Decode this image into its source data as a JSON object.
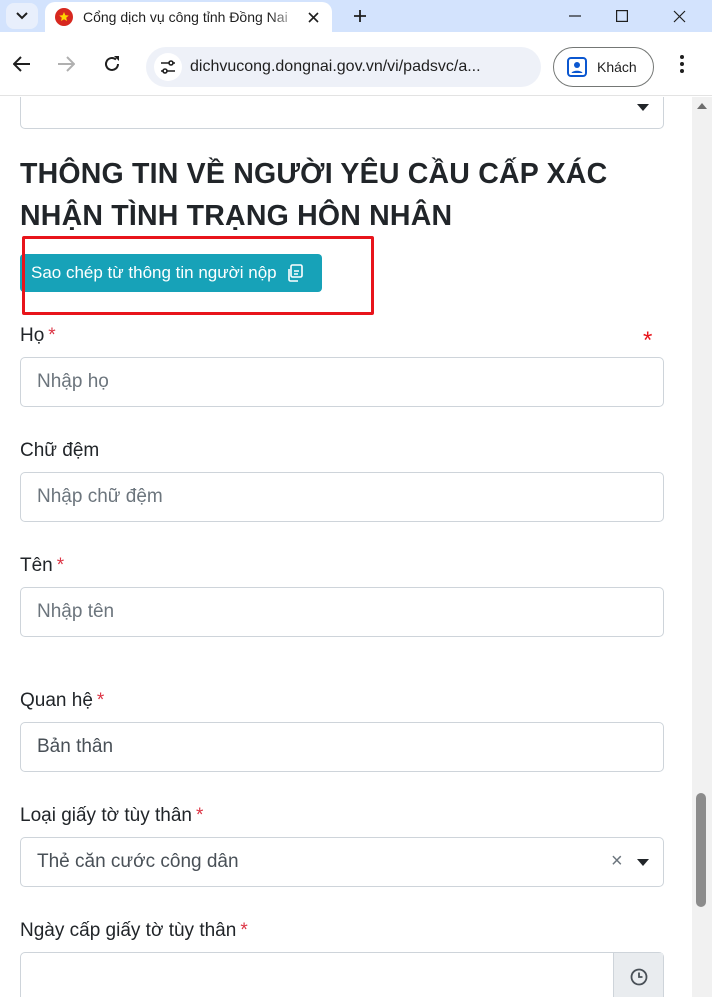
{
  "browser": {
    "tab_title": "Cổng dịch vụ công tỉnh Đồng Nai",
    "url": "dichvucong.dongnai.gov.vn/vi/padsvc/a...",
    "profile_label": "Khách",
    "accent_color": "#d3e3fd",
    "icons": [
      "tab-list-icon",
      "favicon-icon",
      "close-icon",
      "plus-icon",
      "minimize-icon",
      "maximize-icon",
      "window-close-icon",
      "back-icon",
      "forward-icon",
      "reload-icon",
      "site-info-icon",
      "profile-icon",
      "more-icon"
    ]
  },
  "form": {
    "section_title": "THÔNG TIN VỀ NGƯỜI YÊU CẦU CẤP XÁC NHẬN TÌNH TRẠNG HÔN NHÂN",
    "copy_button_label": "Sao chép từ thông tin người nộp",
    "required_mark": "*",
    "fields": {
      "last_name": {
        "label": "Họ",
        "placeholder": "Nhập họ"
      },
      "middle_name": {
        "label": "Chữ đệm",
        "placeholder": "Nhập chữ đệm"
      },
      "first_name": {
        "label": "Tên",
        "placeholder": "Nhập tên"
      },
      "relationship": {
        "label": "Quan hệ",
        "value": "Bản thân"
      },
      "id_type": {
        "label": "Loại giấy tờ tùy thân",
        "value": "Thẻ căn cước công dân",
        "clear_symbol": "×"
      },
      "id_issue_date": {
        "label": "Ngày cấp giấy tờ tùy thân",
        "value": ""
      }
    },
    "colors": {
      "button": "#17a2b8",
      "required": "#dc3545",
      "highlight": "#e8141b"
    }
  }
}
